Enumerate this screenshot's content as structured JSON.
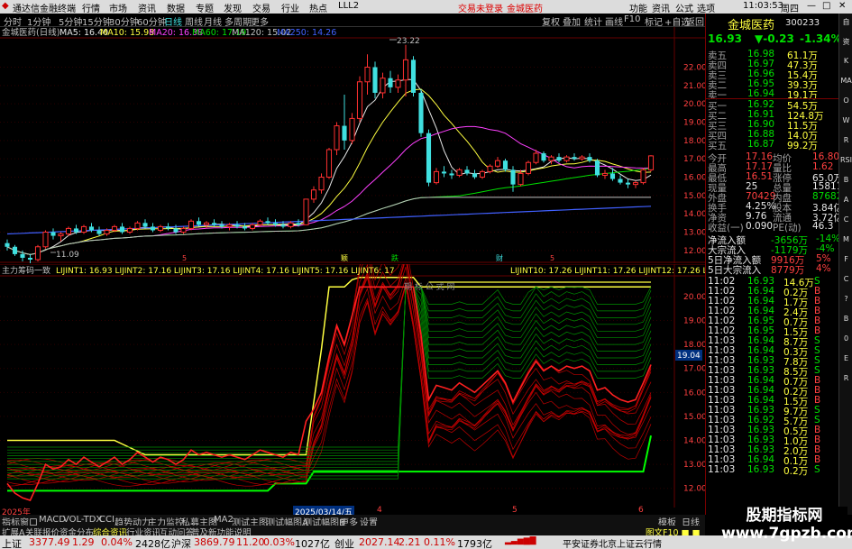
{
  "menubar": {
    "app_title": "通达信金融终端",
    "items": [
      "行情",
      "市场",
      "资讯",
      "数据",
      "专题",
      "发现",
      "交易",
      "行业",
      "热点",
      "LLL2"
    ],
    "notice": "交易未登录",
    "stock_name_top": "金城医药",
    "right_items": [
      "功能",
      "资讯",
      "公式",
      "选项"
    ],
    "time": "11:03:53",
    "weekday": "周四"
  },
  "periodbar": {
    "periods": [
      "分时",
      "1分钟",
      "5分钟",
      "15分钟",
      "30分钟",
      "60分钟",
      "日线",
      "周线",
      "月线",
      "多周期",
      "更多"
    ],
    "tools": [
      "复权",
      "叠加",
      "统计",
      "画线",
      "F10",
      "标记",
      "+自选",
      "返回"
    ]
  },
  "main_chart": {
    "ma_legend": {
      "title": "金城医药(日线)",
      "ma5": "MA5: 16.40",
      "ma10": "MA10: 15.98",
      "ma20": "MA20: 16.38",
      "ma60": "MA60: 17.19",
      "ma120": "MA120: 15.02",
      "ma250": "MA250: 14.26"
    },
    "high_label": "23.22",
    "low_label": "11.09",
    "axis_ticks": [
      "22.00",
      "21.00",
      "20.00",
      "19.00",
      "18.00",
      "17.00",
      "16.00",
      "15.00",
      "14.00",
      "13.00",
      "12.00"
    ],
    "event_marks": [
      "5",
      "颖",
      "跌",
      "财",
      "5"
    ]
  },
  "chart_data": {
    "type": "candlestick",
    "ylim": [
      11.5,
      23.5
    ],
    "ytick_labels": [
      "22.00",
      "21.00",
      "20.00",
      "19.00",
      "18.00",
      "17.00",
      "16.00",
      "15.00",
      "14.00",
      "13.00",
      "12.00"
    ],
    "annotations": [
      "23.22",
      "11.09"
    ],
    "candles_ohlc": [
      [
        12.4,
        12.6,
        12.0,
        12.2
      ],
      [
        12.2,
        12.3,
        11.7,
        11.8
      ],
      [
        11.8,
        12.0,
        11.4,
        11.6
      ],
      [
        11.6,
        11.8,
        11.09,
        11.5
      ],
      [
        11.5,
        12.3,
        11.4,
        12.2
      ],
      [
        12.2,
        13.1,
        12.1,
        13.0
      ],
      [
        13.0,
        13.2,
        12.6,
        12.8
      ],
      [
        12.8,
        13.0,
        12.5,
        12.9
      ],
      [
        12.9,
        13.3,
        12.8,
        13.2
      ],
      [
        13.2,
        13.4,
        12.9,
        13.0
      ],
      [
        13.0,
        13.4,
        12.9,
        13.3
      ],
      [
        13.3,
        13.5,
        13.0,
        13.1
      ],
      [
        13.1,
        13.3,
        12.8,
        12.9
      ],
      [
        12.9,
        13.2,
        12.8,
        13.1
      ],
      [
        13.1,
        13.4,
        13.0,
        13.3
      ],
      [
        13.3,
        13.5,
        12.9,
        13.0
      ],
      [
        13.0,
        13.3,
        12.9,
        13.2
      ],
      [
        13.2,
        13.6,
        13.1,
        13.5
      ],
      [
        13.5,
        13.7,
        13.2,
        13.3
      ],
      [
        13.3,
        13.5,
        13.0,
        13.1
      ],
      [
        13.1,
        13.4,
        13.0,
        13.3
      ],
      [
        13.3,
        13.5,
        13.1,
        13.2
      ],
      [
        13.2,
        13.4,
        12.9,
        13.0
      ],
      [
        13.0,
        13.3,
        12.9,
        13.2
      ],
      [
        13.2,
        13.7,
        13.1,
        13.6
      ],
      [
        13.6,
        13.8,
        13.3,
        13.4
      ],
      [
        13.4,
        13.6,
        13.2,
        13.5
      ],
      [
        13.5,
        13.7,
        13.3,
        13.4
      ],
      [
        13.4,
        13.6,
        13.2,
        13.3
      ],
      [
        13.3,
        13.5,
        13.1,
        13.4
      ],
      [
        13.4,
        13.6,
        13.2,
        13.3
      ],
      [
        13.3,
        13.5,
        13.1,
        13.2
      ],
      [
        13.2,
        13.5,
        13.1,
        13.4
      ],
      [
        13.4,
        13.7,
        13.3,
        13.6
      ],
      [
        13.6,
        13.8,
        13.4,
        13.5
      ],
      [
        13.5,
        13.7,
        13.3,
        13.4
      ],
      [
        13.4,
        13.6,
        13.2,
        13.3
      ],
      [
        13.3,
        13.6,
        13.2,
        13.5
      ],
      [
        13.5,
        13.7,
        13.3,
        13.4
      ],
      [
        13.4,
        14.8,
        13.4,
        14.8
      ],
      [
        14.8,
        15.5,
        14.6,
        15.3
      ],
      [
        15.3,
        16.2,
        15.1,
        16.0
      ],
      [
        16.0,
        17.6,
        15.9,
        17.5
      ],
      [
        17.5,
        19.0,
        17.2,
        18.8
      ],
      [
        18.8,
        20.5,
        17.5,
        18.0
      ],
      [
        18.0,
        19.5,
        17.8,
        19.2
      ],
      [
        19.2,
        21.5,
        19.0,
        21.2
      ],
      [
        21.2,
        22.7,
        20.5,
        22.0
      ],
      [
        22.0,
        22.3,
        20.3,
        20.6
      ],
      [
        20.6,
        21.7,
        20.3,
        21.4
      ],
      [
        21.4,
        21.8,
        20.6,
        20.9
      ],
      [
        20.9,
        21.6,
        20.6,
        21.3
      ],
      [
        21.3,
        23.22,
        20.4,
        22.4
      ],
      [
        22.4,
        22.6,
        20.4,
        20.6
      ],
      [
        20.6,
        20.8,
        18.2,
        18.4
      ],
      [
        18.4,
        18.6,
        15.5,
        15.7
      ],
      [
        15.7,
        16.5,
        15.6,
        16.3
      ],
      [
        16.3,
        16.6,
        16.0,
        16.2
      ],
      [
        16.2,
        16.4,
        15.9,
        16.1
      ],
      [
        16.1,
        16.5,
        16.0,
        16.4
      ],
      [
        16.4,
        16.6,
        16.1,
        16.2
      ],
      [
        16.2,
        16.4,
        15.9,
        16.0
      ],
      [
        16.0,
        16.4,
        15.9,
        16.3
      ],
      [
        16.3,
        16.7,
        16.2,
        16.6
      ],
      [
        16.6,
        17.1,
        16.5,
        16.9
      ],
      [
        16.9,
        17.0,
        16.3,
        16.4
      ],
      [
        16.4,
        16.6,
        15.2,
        15.6
      ],
      [
        15.6,
        16.4,
        15.5,
        16.2
      ],
      [
        16.2,
        16.9,
        16.1,
        16.8
      ],
      [
        16.8,
        17.5,
        16.7,
        17.3
      ],
      [
        17.3,
        17.4,
        16.8,
        16.9
      ],
      [
        16.9,
        17.2,
        16.7,
        17.1
      ],
      [
        17.1,
        17.3,
        16.8,
        16.9
      ],
      [
        16.9,
        17.2,
        16.8,
        17.1
      ],
      [
        17.1,
        17.3,
        16.9,
        17.0
      ],
      [
        17.0,
        17.2,
        16.9,
        17.1
      ],
      [
        17.1,
        17.3,
        16.8,
        16.9
      ],
      [
        16.9,
        17.0,
        16.0,
        16.1
      ],
      [
        16.1,
        16.4,
        15.9,
        16.2
      ],
      [
        16.2,
        16.5,
        15.8,
        15.9
      ],
      [
        15.9,
        16.1,
        15.6,
        15.7
      ],
      [
        15.7,
        15.9,
        15.4,
        15.6
      ],
      [
        15.6,
        15.8,
        15.4,
        15.7
      ],
      [
        15.7,
        16.5,
        15.6,
        16.4
      ],
      [
        16.4,
        17.2,
        16.3,
        17.16
      ]
    ]
  },
  "sub_chart": {
    "title": "主力筹码一致",
    "lines_left": "LIJINT1: 16.93 LIJINT2: 17.16 LIJINT3: 17.16 LIJINT4: 17.16 LIJINT5: 17.16 LIJINT6: 17",
    "lines_right": "LIJINT10: 17.26 LIJINT11: 17.26 LIJINT12: 17.26 LIJ",
    "watermark": "期 标 公 式 网",
    "axis_ticks": [
      "20.00",
      "19.00",
      "18.00",
      "17.00",
      "16.00",
      "15.00",
      "14.00",
      "13.00",
      "12.00"
    ],
    "cursor_value": "19.04"
  },
  "datebar": {
    "d1": "2025年",
    "d2": "2025/03/14/五",
    "d3": "4",
    "d4": "5",
    "d5": "6"
  },
  "tabbar": {
    "tabs": [
      "指标",
      "窗口",
      "MACD",
      "VOL-TDX",
      "CCI",
      "趋势动力",
      "主力监控",
      "私募主图",
      "MA2",
      "测试主图",
      "测试幅图A",
      "测试幅图B",
      "更多",
      "设置"
    ],
    "right": [
      "模板",
      "日线"
    ]
  },
  "tabbar2": {
    "tabs": [
      "扩展A",
      "关联报价",
      "资金分布",
      "综合资讯",
      "行业资讯",
      "互动问答",
      "普及新功能说明"
    ],
    "right": "图文F10 ■ ■"
  },
  "quote_panel": {
    "name": "金城医药",
    "code": "300233",
    "price": "16.93",
    "change": "▼-0.23",
    "pct": "-1.34%",
    "order_book": [
      {
        "label": "卖五",
        "price": "16.98",
        "vol": "61.1万"
      },
      {
        "label": "卖四",
        "price": "16.97",
        "vol": "47.3万"
      },
      {
        "label": "卖三",
        "price": "16.96",
        "vol": "15.4万"
      },
      {
        "label": "卖二",
        "price": "16.95",
        "vol": "39.3万"
      },
      {
        "label": "卖一",
        "price": "16.94",
        "vol": "19.1万"
      },
      {
        "label": "买一",
        "price": "16.92",
        "vol": "54.5万"
      },
      {
        "label": "买二",
        "price": "16.91",
        "vol": "124.8万"
      },
      {
        "label": "买三",
        "price": "16.90",
        "vol": "11.5万"
      },
      {
        "label": "买四",
        "price": "16.88",
        "vol": "14.0万"
      },
      {
        "label": "买五",
        "price": "16.87",
        "vol": "99.2万"
      }
    ],
    "stats": [
      {
        "l1": "今开",
        "v1": "17.16",
        "l2": "均价",
        "v2": "16.80"
      },
      {
        "l1": "最高",
        "v1": "17.17",
        "l2": "量比",
        "v2": "1.62"
      },
      {
        "l1": "最低",
        "v1": "16.51",
        "l2": "涨停",
        "v2": "65.0万"
      },
      {
        "l1": "现量",
        "v1": "25",
        "l2": "总量",
        "v2": "158111"
      },
      {
        "l1": "外盘",
        "v1": "70429",
        "l2": "内盘",
        "v2": "87682"
      },
      {
        "l1": "换手",
        "v1": "4.25%",
        "l2": "股本",
        "v2": "3.84亿"
      },
      {
        "l1": "净资",
        "v1": "9.76",
        "l2": "流通",
        "v2": "3.72亿"
      },
      {
        "l1": "收益(一)",
        "v1": "0.090",
        "l2": "PE(动)",
        "v2": "46.3"
      }
    ],
    "flows": [
      {
        "label": "净流入额",
        "value": "-3656万",
        "pct": "-14%"
      },
      {
        "label": "大宗流入",
        "value": "-1179万",
        "pct": "-4%"
      },
      {
        "label": "5日净流入额",
        "value": "9916万",
        "pct": "5%"
      },
      {
        "label": "5日大宗流入",
        "value": "8779万",
        "pct": "4%"
      }
    ],
    "ticks": [
      {
        "t": "11:02",
        "p": "16.93",
        "v": "14.6万",
        "s": "S"
      },
      {
        "t": "11:02",
        "p": "16.94",
        "v": "0.2万",
        "s": "B"
      },
      {
        "t": "11:02",
        "p": "16.94",
        "v": "1.7万",
        "s": "B"
      },
      {
        "t": "11:02",
        "p": "16.94",
        "v": "2.4万",
        "s": "B"
      },
      {
        "t": "11:02",
        "p": "16.95",
        "v": "0.7万",
        "s": "B"
      },
      {
        "t": "11:02",
        "p": "16.95",
        "v": "1.5万",
        "s": "B"
      },
      {
        "t": "11:03",
        "p": "16.94",
        "v": "8.7万",
        "s": "S"
      },
      {
        "t": "11:03",
        "p": "16.94",
        "v": "0.3万",
        "s": "S"
      },
      {
        "t": "11:03",
        "p": "16.93",
        "v": "7.8万",
        "s": "S"
      },
      {
        "t": "11:03",
        "p": "16.93",
        "v": "8.5万",
        "s": "S"
      },
      {
        "t": "11:03",
        "p": "16.94",
        "v": "0.7万",
        "s": "B"
      },
      {
        "t": "11:03",
        "p": "16.94",
        "v": "0.2万",
        "s": "B"
      },
      {
        "t": "11:03",
        "p": "16.94",
        "v": "1.5万",
        "s": "B"
      },
      {
        "t": "11:03",
        "p": "16.93",
        "v": "9.7万",
        "s": "S"
      },
      {
        "t": "11:03",
        "p": "16.92",
        "v": "5.7万",
        "s": "S"
      },
      {
        "t": "11:03",
        "p": "16.93",
        "v": "0.5万",
        "s": "B"
      },
      {
        "t": "11:03",
        "p": "16.93",
        "v": "1.0万",
        "s": "B"
      },
      {
        "t": "11:03",
        "p": "16.93",
        "v": "2.0万",
        "s": "B"
      },
      {
        "t": "11:03",
        "p": "16.94",
        "v": "0.1万",
        "s": "B"
      },
      {
        "t": "11:03",
        "p": "16.93",
        "v": "0.2万",
        "s": "S"
      }
    ]
  },
  "right_strip": [
    "自",
    "资",
    "K",
    "MA",
    "O",
    "W",
    "R",
    "RSI",
    "B",
    "A",
    "C",
    "M",
    "F",
    "C",
    "?",
    "B",
    "0",
    "E",
    "R"
  ],
  "statusbar": {
    "sh_label": "上证",
    "sh_val": "3377.49",
    "sh_chg": "1.29",
    "sh_pct": "0.04%",
    "sh_amt": "2428亿",
    "sz_label": "沪深",
    "sz_val": "3869.79",
    "sz_chg": "11.20",
    "sz_pct": "0.03%",
    "sz_amt": "1027亿",
    "cy_label": "创业",
    "cy_val": "2027.14",
    "cy_chg": "2.21",
    "cy_pct": "0.11%",
    "cy_amt": "1793亿",
    "right": "平安证券北京上证云行情"
  },
  "watermark": "股期指标网 www.7gpzb.com"
}
